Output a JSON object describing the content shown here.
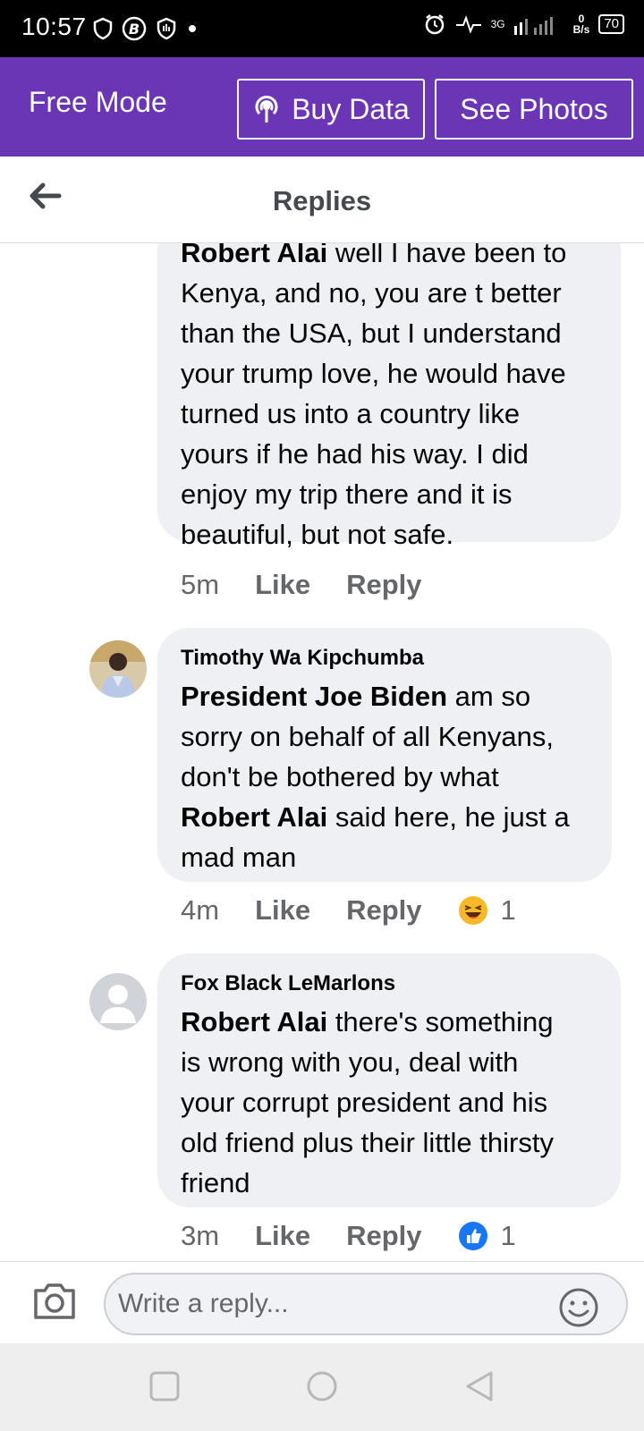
{
  "status_bar": {
    "time": "10:57",
    "network": "3G",
    "speed_value": "0",
    "speed_unit": "B/s",
    "battery": "70"
  },
  "free_mode": {
    "title": "Free Mode",
    "buy_data_label": "Buy Data",
    "see_photos_label": "See Photos"
  },
  "header": {
    "title": "Replies"
  },
  "comments": [
    {
      "author": "",
      "mention": "Robert Alai",
      "text_lines": [
        " well I have been to",
        "Kenya, and no, you are t better",
        "than the USA, but I understand",
        "your trump love, he would have",
        "turned us into a country like",
        "yours if he had his way.  I did",
        "enjoy my trip there and it is",
        "beautiful, but not safe."
      ],
      "time": "5m",
      "like": "Like",
      "reply": "Reply"
    },
    {
      "author": "Timothy Wa Kipchumba",
      "mention": "President Joe Biden",
      "line1_rest": " am so",
      "line2": "sorry on behalf of all Kenyans,",
      "line3": "don't be bothered by what",
      "mention2": "Robert Alai",
      "line4_rest": " said here, he just a",
      "line5": "mad man",
      "time": "4m",
      "like": "Like",
      "reply": "Reply",
      "reaction_count": "1"
    },
    {
      "author": "Fox Black LeMarlons",
      "mention": "Robert Alai",
      "line1_rest": " there's something",
      "line2": "is wrong with you, deal with",
      "line3": "your corrupt president and his",
      "line4": "old friend plus their little thirsty",
      "line5": "friend",
      "time": "3m",
      "like": "Like",
      "reply": "Reply",
      "reaction_count": "1"
    }
  ],
  "composer": {
    "placeholder": "Write a reply..."
  },
  "colors": {
    "brand_purple": "#6b36b5",
    "bubble": "#eff0f4",
    "muted_text": "#65676b",
    "like_blue": "#1877f2"
  }
}
